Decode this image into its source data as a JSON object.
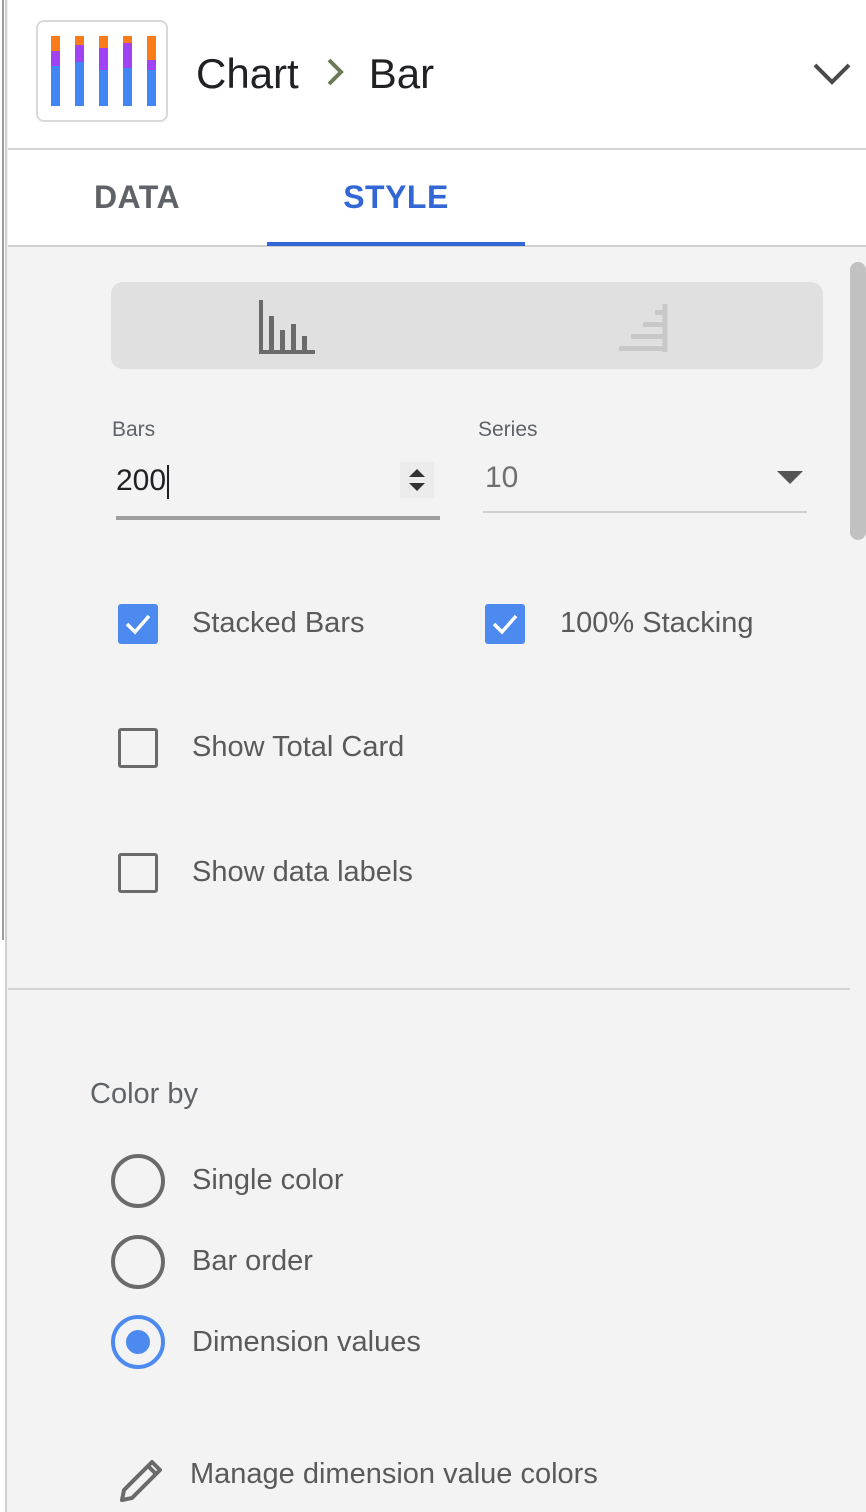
{
  "header": {
    "breadcrumb_root": "Chart",
    "breadcrumb_current": "Bar"
  },
  "tabs": [
    {
      "label": "DATA",
      "active": false
    },
    {
      "label": "STYLE",
      "active": true
    }
  ],
  "style": {
    "orientation_options": [
      "vertical-bars-icon",
      "horizontal-bars-icon"
    ],
    "selected_orientation": "vertical-bars-icon",
    "bars": {
      "label": "Bars",
      "value": "200"
    },
    "series": {
      "label": "Series",
      "value": "10"
    },
    "checkboxes": {
      "stacked_bars": {
        "label": "Stacked Bars",
        "checked": true
      },
      "stacking_100": {
        "label": "100% Stacking",
        "checked": true
      },
      "show_total_card": {
        "label": "Show Total Card",
        "checked": false
      },
      "show_data_labels": {
        "label": "Show data labels",
        "checked": false
      }
    },
    "color_by": {
      "title": "Color by",
      "options": [
        {
          "label": "Single color",
          "selected": false
        },
        {
          "label": "Bar order",
          "selected": false
        },
        {
          "label": "Dimension values",
          "selected": true
        }
      ],
      "manage_link": "Manage dimension value colors"
    }
  },
  "colors": {
    "accent": "#3367d6",
    "checkbox": "#4d8af0",
    "thumb_blue": "#4285f4",
    "thumb_purple": "#a142f4",
    "thumb_orange": "#fa7b17"
  }
}
